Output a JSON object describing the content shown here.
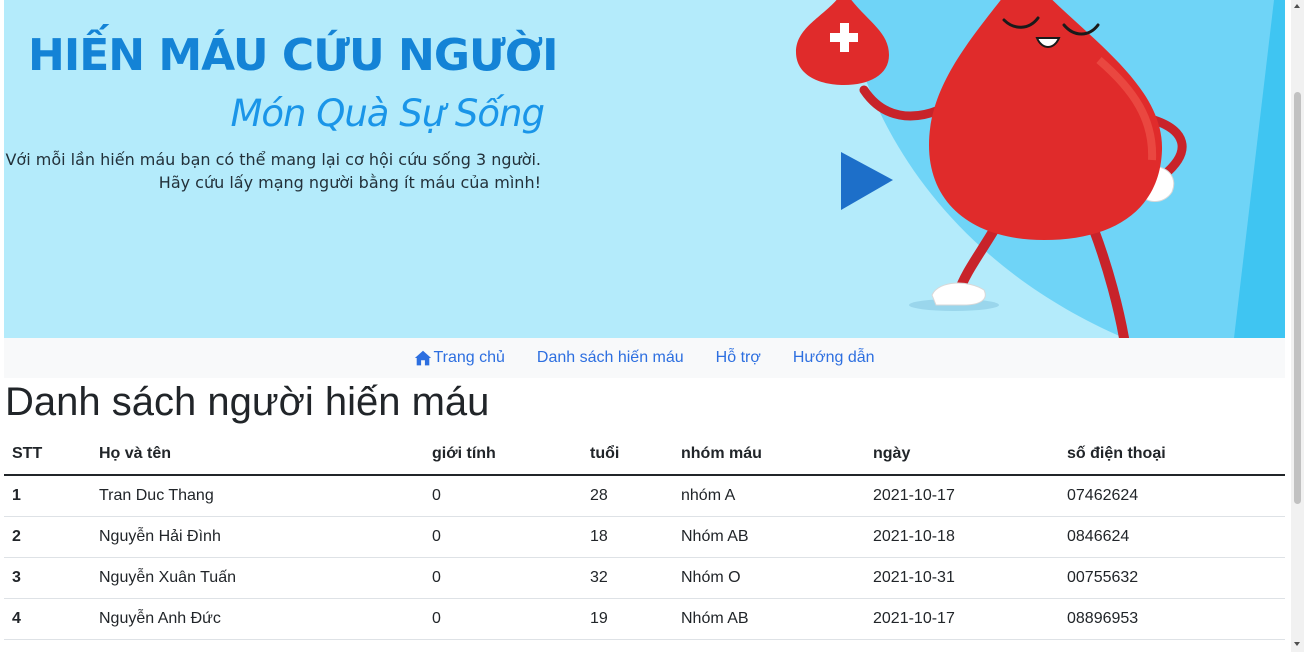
{
  "banner": {
    "title": "HIẾN MÁU CỨU NGƯỜI",
    "subtitle": "Món Quà Sự Sống",
    "line1": "Với mỗi lần hiến máu bạn có thể mang lại cơ hội cứu sống 3 người.",
    "line2": "Hãy cứu lấy mạng người bằng ít máu của mình!",
    "mascot": "blood-drop-mascot",
    "background_color": "#b4ebfb",
    "title_color": "#1483d6",
    "drop_color": "#e02b2b"
  },
  "nav": {
    "items": [
      {
        "label": "Trang chủ",
        "icon": "home-icon"
      },
      {
        "label": "Danh sách hiến máu"
      },
      {
        "label": "Hỗ trợ"
      },
      {
        "label": "Hướng dẫn"
      }
    ],
    "link_color": "#2d6fe0"
  },
  "page": {
    "heading": "Danh sách người hiến máu"
  },
  "table": {
    "headers": [
      "STT",
      "Họ và tên",
      "giới tính",
      "tuổi",
      "nhóm máu",
      "ngày",
      "số điện thoại"
    ],
    "rows": [
      [
        "1",
        "Tran Duc Thang",
        "0",
        "28",
        "nhóm A",
        "2021-10-17",
        "07462624"
      ],
      [
        "2",
        "Nguyễn Hải Đình",
        "0",
        "18",
        "Nhóm AB",
        "2021-10-18",
        "0846624"
      ],
      [
        "3",
        "Nguyễn Xuân Tuấn",
        "0",
        "32",
        "Nhóm O",
        "2021-10-31",
        "00755632"
      ],
      [
        "4",
        "Nguyễn Anh Đức",
        "0",
        "19",
        "Nhóm AB",
        "2021-10-17",
        "08896953"
      ]
    ]
  }
}
